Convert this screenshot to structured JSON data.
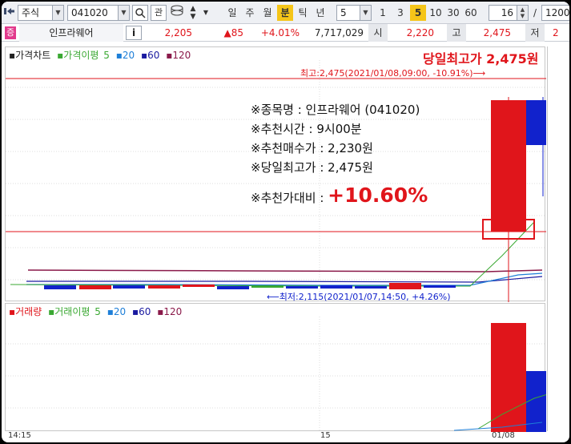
{
  "toolbar": {
    "market_select": "주식",
    "code_input": "041020",
    "search_label": "관",
    "periods": [
      {
        "label": "일",
        "active": false
      },
      {
        "label": "주",
        "active": false
      },
      {
        "label": "월",
        "active": false
      },
      {
        "label": "분",
        "active": true
      },
      {
        "label": "틱",
        "active": false
      },
      {
        "label": "년",
        "active": false
      }
    ],
    "interval_select": "5",
    "interval_buttons": [
      {
        "label": "1",
        "active": false
      },
      {
        "label": "3",
        "active": false
      },
      {
        "label": "5",
        "active": true
      },
      {
        "label": "10",
        "active": false
      },
      {
        "label": "30",
        "active": false
      },
      {
        "label": "60",
        "active": false
      }
    ],
    "count_value": "16",
    "count_sep": "/",
    "count_total": "1200"
  },
  "quote": {
    "badge": "증",
    "name": "인프라웨어",
    "info_button": "i",
    "price": "2,205",
    "change": "▲85",
    "change_pct": "+4.01%",
    "volume": "7,717,029",
    "open_label": "시",
    "open": "2,220",
    "high_label": "고",
    "high": "2,475",
    "low_label": "저",
    "low": "2"
  },
  "price_pane": {
    "legend_title": "가격차트",
    "legend_ma_label": "가격이평",
    "legend_ma": [
      "5",
      "20",
      "60",
      "120"
    ],
    "headline": "당일최고가 2,475원",
    "high_marker": "최고:2,475(2021/01/08,09:00, -10.91%)⟶",
    "low_marker": "⟵최저:2,115(2021/01/07,14:50, +4.26%)",
    "notes": [
      "※종목명 : 인프라웨어 (041020)",
      "※추천시간 : 9시00분",
      "※추천매수가 : 2,230원",
      "※당일최고가 : 2,475원"
    ],
    "compare_label": "※추천가대비 :",
    "compare_value": "+10.60%"
  },
  "volume_pane": {
    "legend_title": "거래량",
    "legend_ma_label": "거래이평",
    "legend_ma": [
      "5",
      "20",
      "60",
      "120"
    ]
  },
  "time_axis": [
    "14:15",
    "15",
    "01/08"
  ],
  "colors": {
    "up": "#e0151b",
    "down": "#1122cc",
    "ma5": "#3aa832",
    "ma20": "#1e7fd8",
    "ma60": "#1a1aa0",
    "ma120": "#8a1a4a",
    "active": "#f5c518"
  }
}
